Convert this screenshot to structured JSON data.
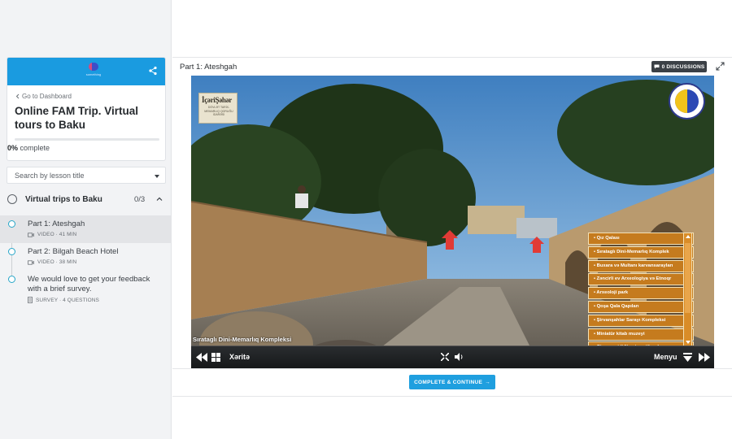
{
  "sidebar": {
    "brand_text": "something",
    "back_link": "Go to Dashboard",
    "course_title": "Online FAM Trip. Virtual tours to Baku",
    "progress_percent": "0%",
    "progress_label": " complete",
    "progress_fraction": 0,
    "search_placeholder": "Search by lesson title",
    "section": {
      "title": "Virtual trips to Baku",
      "count": "0/3"
    },
    "lessons": [
      {
        "title": "Part 1: Ateshgah",
        "meta": "VIDEO · 41 MIN",
        "type": "video",
        "active": true
      },
      {
        "title": "Part 2: Bilgah Beach Hotel",
        "meta": "VIDEO · 38 MIN",
        "type": "video",
        "active": false
      },
      {
        "title": "We would love to get your feedback with a brief survey.",
        "meta": "SURVEY · 4 QUESTIONS",
        "type": "survey",
        "active": false
      }
    ]
  },
  "main": {
    "lesson_header": "Part 1: Ateshgah",
    "discussions_label": "0 DISCUSSIONS",
    "complete_button": "COMPLETE & CONTINUE",
    "complete_arrow": "→"
  },
  "tour": {
    "logo_name": "İçəriŞəhər",
    "logo_subtitle": "DÖVLƏT TARİX-MEMARLIQ QORUĞU İDARƏSİ",
    "caption": "Sırataglı Dini-Memarlıq Kompleksi",
    "menu_items": [
      "Qız Qalası",
      "Sırataglı Dini-Memarlıq Komplek",
      "Buxara və Multanı karvansarayları",
      "Zəncirli ev Arxeologiya və Etnoqr",
      "Arxeoloji park",
      "Qoşa Qala Qapıları",
      "Şirvanşahlar Sarayı Kompleksi",
      "Miniatür kitab muzeyi",
      "Cin məscidi Numizmatika ekspo"
    ],
    "toolbar": {
      "map_label": "Xəritə",
      "menu_label": "Menyu"
    }
  },
  "colors": {
    "accent": "#1a9be0",
    "timeline": "#27a6c8",
    "menu_orange": "#c57b1e"
  }
}
